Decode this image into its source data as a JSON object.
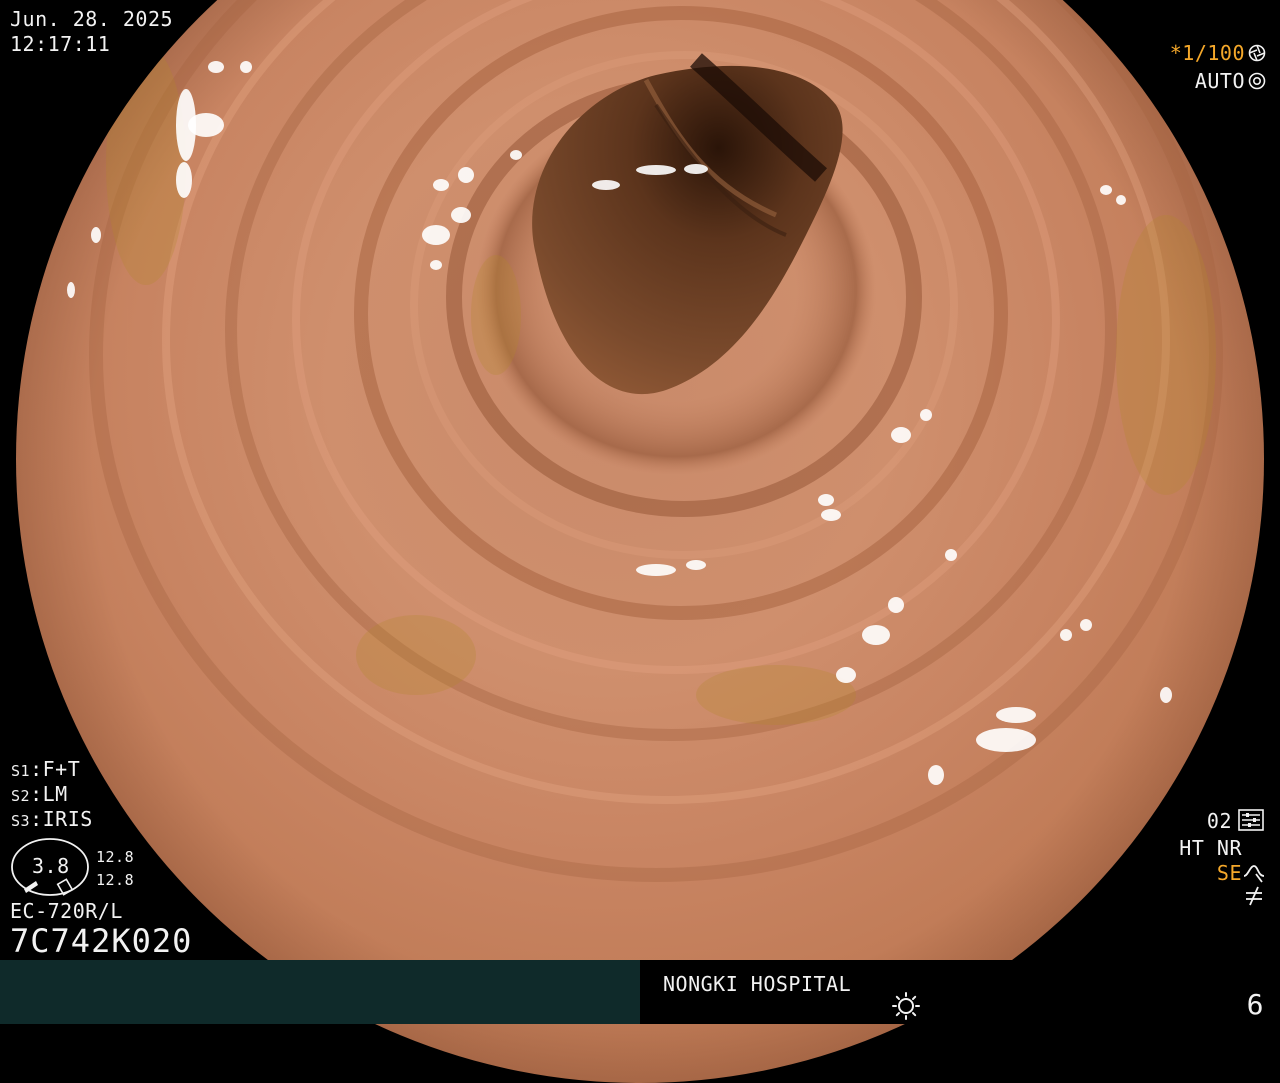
{
  "header": {
    "date": "Jun. 28. 2025",
    "time": "12:17:11"
  },
  "exposure": {
    "shutter": "*1/100",
    "shutter_icon": "shutter-icon",
    "mode": "AUTO",
    "mode_icon": "iris-icon"
  },
  "switches": {
    "s1": {
      "label": "S1",
      "value": "F+T"
    },
    "s2": {
      "label": "S2",
      "value": "LM"
    },
    "s3": {
      "label": "S3",
      "value": "IRIS"
    }
  },
  "zoom": {
    "value": "3.8",
    "upper": "12.8",
    "lower": "12.8"
  },
  "scope": {
    "model": "EC-720R/L",
    "serial": "7C742K020"
  },
  "processing": {
    "preset": "02",
    "preset_icon": "settings-sliders-icon",
    "ht_nr": "HT NR",
    "se": "SE",
    "se_icon": "enhance-curve-icon",
    "nf_icon": "not-equal-icon"
  },
  "footer": {
    "hospital": "NONGKI HOSPITAL",
    "light_icon": "light-source-icon",
    "page": "6"
  },
  "colors": {
    "overlay_text": "#f2f2f2",
    "highlight": "#f5a82a",
    "bottom_bar_left": "#0f2a2a",
    "mucosa": "#cf8f6d"
  }
}
